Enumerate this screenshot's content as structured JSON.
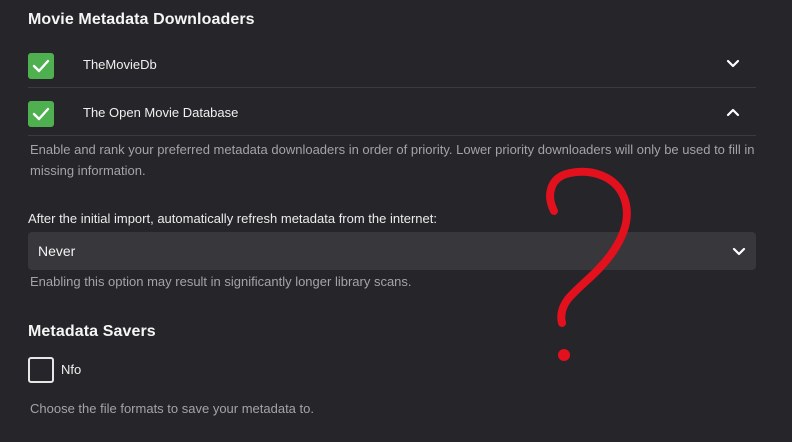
{
  "downloaders": {
    "title": "Movie Metadata Downloaders",
    "items": [
      {
        "label": "TheMovieDb",
        "checked": true,
        "expanded": false
      },
      {
        "label": "The Open Movie Database",
        "checked": true,
        "expanded": true
      }
    ],
    "help": "Enable and rank your preferred metadata downloaders in order of priority. Lower priority downloaders will only be used to fill in missing information."
  },
  "refresh": {
    "label": "After the initial import, automatically refresh metadata from the internet:",
    "value": "Never",
    "help": "Enabling this option may result in significantly longer library scans."
  },
  "savers": {
    "title": "Metadata Savers",
    "items": [
      {
        "label": "Nfo",
        "checked": false
      }
    ],
    "help": "Choose the file formats to save your metadata to."
  },
  "colors": {
    "background": "#262529",
    "checked": "#4fb04f",
    "annotation": "#e3101e"
  },
  "icons": {
    "checkmark": "checkmark-icon",
    "chevron_down": "chevron-down-icon",
    "chevron_up": "chevron-up-icon"
  }
}
